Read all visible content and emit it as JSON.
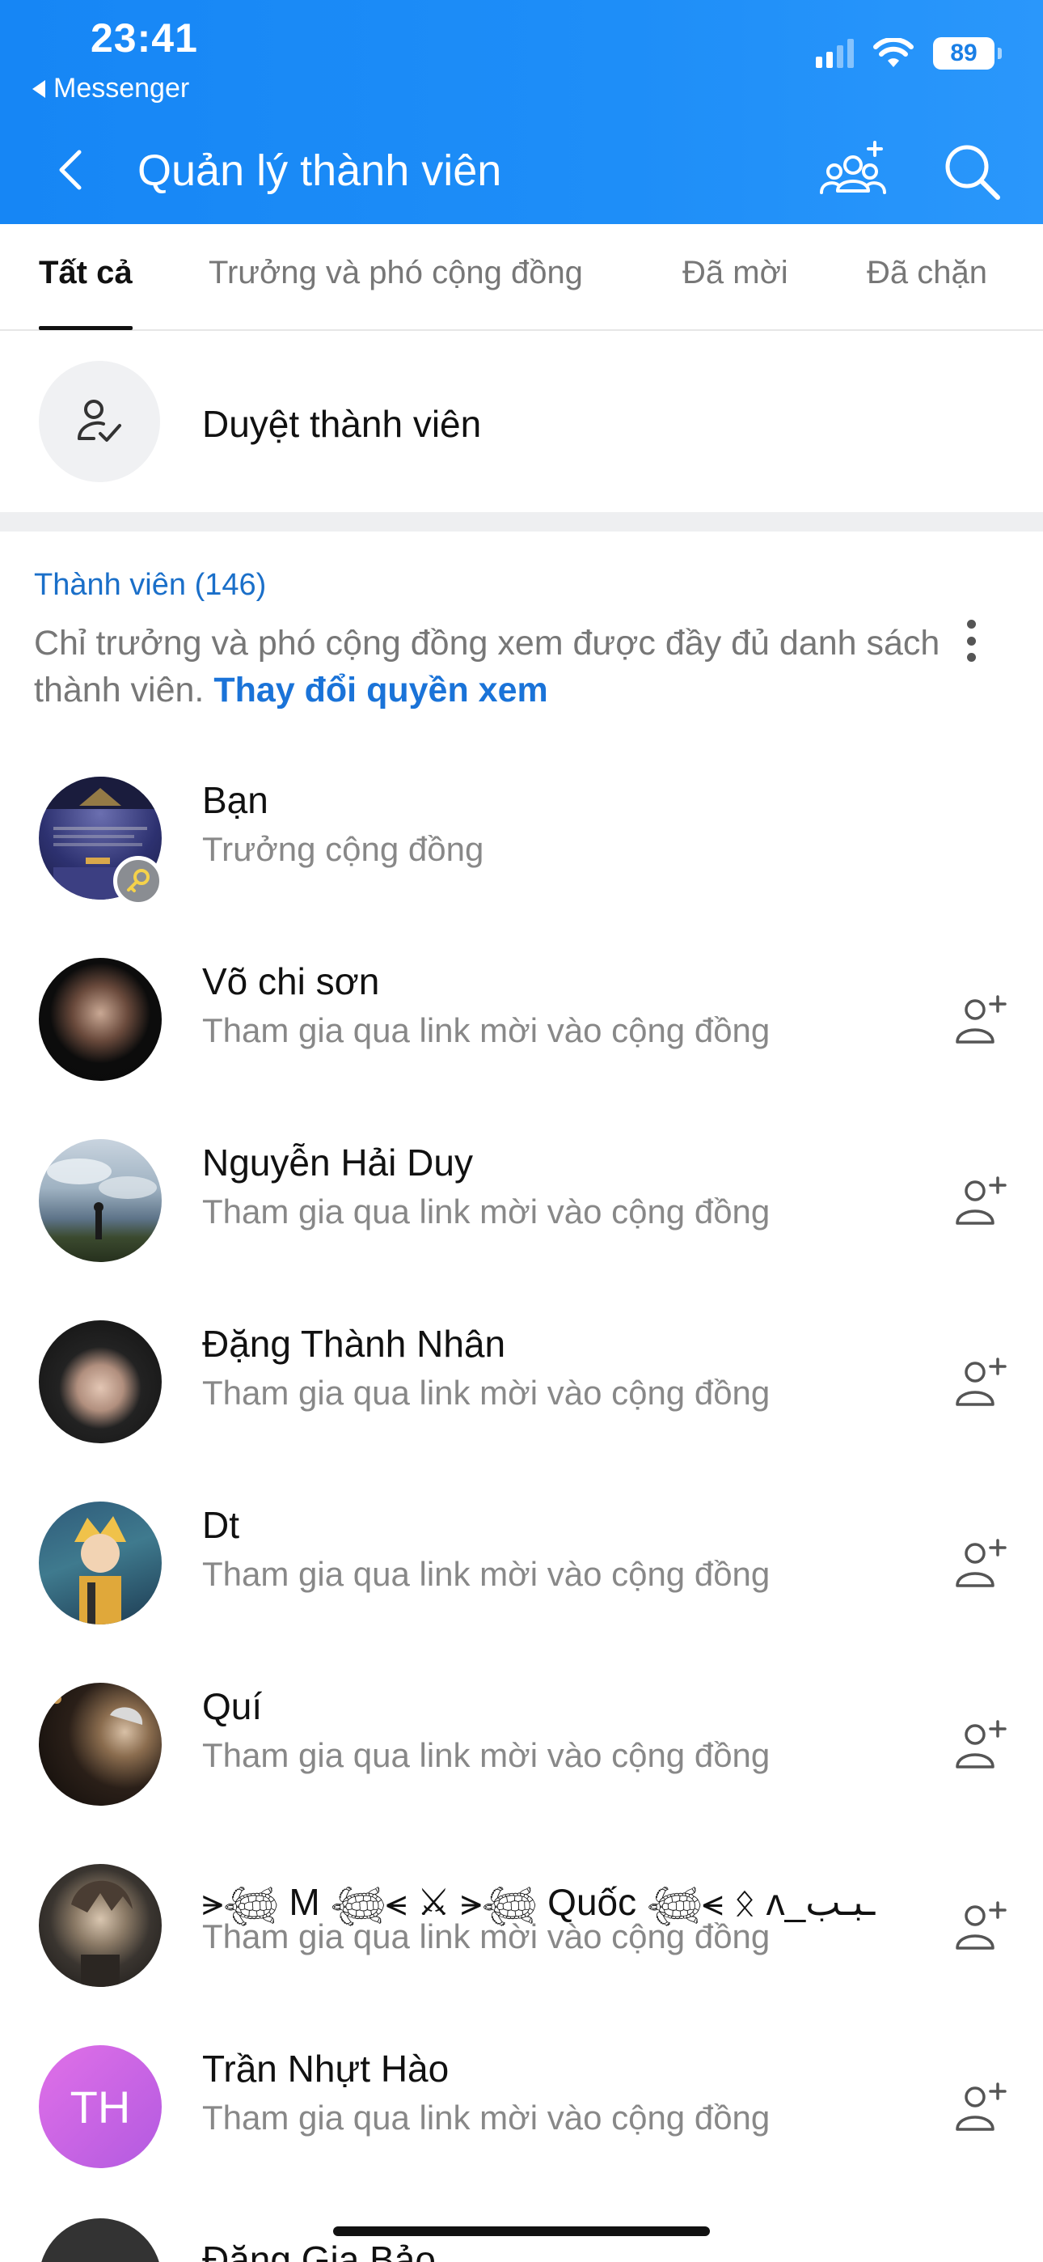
{
  "status": {
    "time": "23:41",
    "back_app": "Messenger",
    "battery": "89"
  },
  "header": {
    "title": "Quản lý thành viên"
  },
  "tabs": [
    {
      "label": "Tất cả"
    },
    {
      "label": "Trưởng và phó cộng đồng"
    },
    {
      "label": "Đã mời"
    },
    {
      "label": "Đã chặn"
    }
  ],
  "review": {
    "label": "Duyệt thành viên"
  },
  "members_section": {
    "title": "Thành viên (146)",
    "desc": "Chỉ trưởng và phó cộng đồng xem được đầy đủ danh sách thành viên.",
    "link": "Thay đổi quyền xem"
  },
  "members": [
    {
      "name": "Bạn",
      "sub": "Trưởng cộng đồng"
    },
    {
      "name": "Võ chi sơn",
      "sub": "Tham gia qua link mời vào cộng đồng"
    },
    {
      "name": "Nguyễn Hải Duy",
      "sub": "Tham gia qua link mời vào cộng đồng"
    },
    {
      "name": "Đặng Thành Nhân",
      "sub": "Tham gia qua link mời vào cộng đồng"
    },
    {
      "name": "Dt",
      "sub": "Tham gia qua link mời vào cộng đồng"
    },
    {
      "name": "Quí",
      "sub": "Tham gia qua link mời vào cộng đồng"
    },
    {
      "name": "⪫𓆉 M 𓆉⪪ ⚔ ⪫𓆉 Quốc 𓆉⪪ ᛟ ʌ_ـبـب",
      "sub": "Tham gia qua link mời vào cộng đồng"
    },
    {
      "name": "Trần Nhựt Hào",
      "sub": "Tham gia qua link mời vào cộng đồng",
      "initials": "TH"
    }
  ],
  "peek": {
    "name": "Đặng Gia Bảo"
  },
  "colors": {
    "header": "#1e8ef8",
    "link": "#1a73d8",
    "section_title": "#1a6fc9"
  }
}
